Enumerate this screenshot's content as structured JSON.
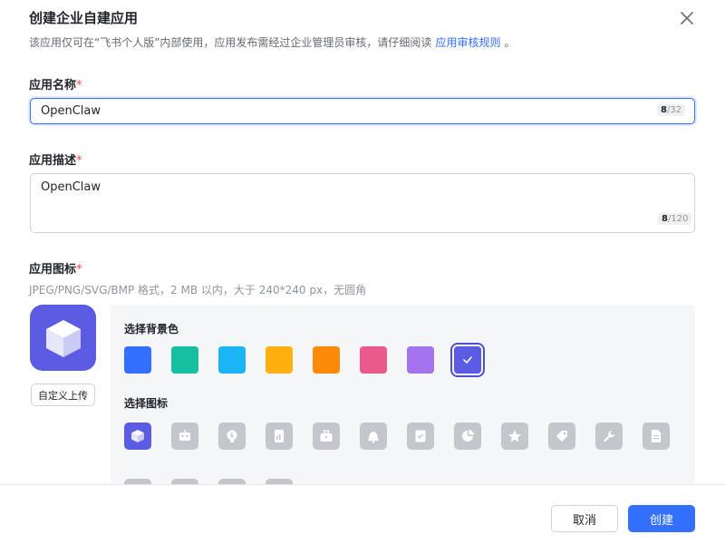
{
  "dialog": {
    "title": "创建企业自建应用",
    "subtitle": "该应用仅可在“飞书个人版”内部使用，应用发布需经过企业管理员审核，请仔细阅读",
    "subtitle_link": "应用审核规则",
    "subtitle_end": "。"
  },
  "name_field": {
    "label": "应用名称",
    "required_mark": "*",
    "value": "OpenClaw",
    "count_current": "8",
    "count_max": "/32"
  },
  "desc_field": {
    "label": "应用描述",
    "required_mark": "*",
    "value": "OpenClaw",
    "count_current": "8",
    "count_max": "/120"
  },
  "icon_field": {
    "label": "应用图标",
    "required_mark": "*",
    "hint": "JPEG/PNG/SVG/BMP 格式，2 MB 以内，大于 240*240 px，无圆角",
    "upload_label": "自定义上传",
    "preview_icon": "cube-icon",
    "preview_color": "#5b5ce2"
  },
  "picker": {
    "bg_label": "选择背景色",
    "icon_label": "选择图标",
    "colors": [
      "#3370ff",
      "#14c0a0",
      "#1bb4f5",
      "#ffb20f",
      "#fe8a0a",
      "#ea5a8b",
      "#a373f0",
      "#5b5ce2"
    ],
    "selected_color": "#5b5ce2",
    "icons": [
      "cube-icon",
      "robot-icon",
      "bulb-icon",
      "document-chart-icon",
      "briefcase-icon",
      "bell-icon",
      "checklist-icon",
      "pie-icon",
      "star-icon",
      "tag-icon",
      "wrench-icon",
      "file-icon",
      "shield-icon",
      "card-icon",
      "people-icon",
      "globe-icon"
    ],
    "selected_icon": "cube-icon"
  },
  "footer": {
    "cancel_label": "取消",
    "create_label": "创建"
  }
}
